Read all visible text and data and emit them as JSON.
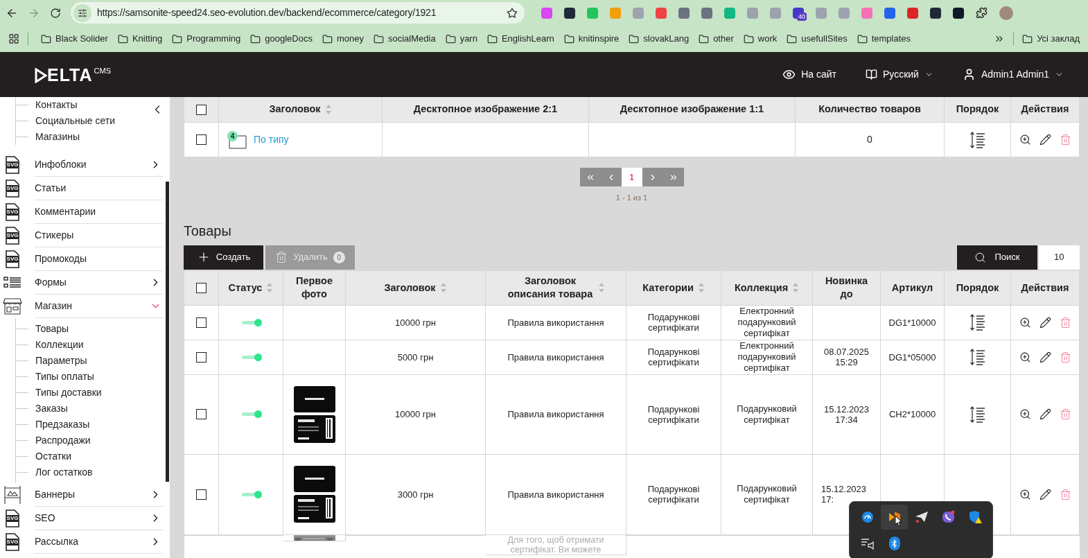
{
  "browser": {
    "url": "https://samsonite-speed24.seo-evolution.dev/backend/ecommerce/category/1921",
    "extension_badge": "40",
    "bookmarks": [
      "Black Solider",
      "Knitting",
      "Programming",
      "googleDocs",
      "money",
      "socialMedia",
      "yarn",
      "EnglishLearn",
      "knitinspire",
      "slovakLang",
      "other",
      "work",
      "usefullSites",
      "templates"
    ],
    "all_bookmarks": "Усі заклад"
  },
  "header": {
    "logo": "ELTA",
    "logo_sup": "CMS",
    "site_link": "На сайт",
    "language": "Русский",
    "user": "Admin1 Admin1"
  },
  "sidebar": {
    "partial_children": [
      "Контакты",
      "Социальные сети",
      "Магазины"
    ],
    "items": [
      {
        "label": "Инфоблоки",
        "kind": "group",
        "icon_label": "SVG",
        "expanded": false
      },
      {
        "label": "Статьи",
        "kind": "link",
        "icon_label": "SVG"
      },
      {
        "label": "Комментарии",
        "kind": "link",
        "icon_label": "SVG"
      },
      {
        "label": "Стикеры",
        "kind": "link",
        "icon_label": "SVG"
      },
      {
        "label": "Промокоды",
        "kind": "link",
        "icon_label": "SVG"
      },
      {
        "label": "Формы",
        "kind": "group",
        "expanded": false
      },
      {
        "label": "Магазин",
        "kind": "group",
        "expanded": true,
        "children": [
          "Товары",
          "Коллекции",
          "Параметры",
          "Типы оплаты",
          "Типы доставки",
          "Заказы",
          "Предзаказы",
          "Распродажи",
          "Остатки",
          "Лог остатков"
        ]
      },
      {
        "label": "Баннеры",
        "kind": "group",
        "expanded": false
      },
      {
        "label": "SEO",
        "kind": "group",
        "icon_label": "SVG",
        "expanded": false
      },
      {
        "label": "Рассылка",
        "kind": "group",
        "icon_label": "SVG",
        "expanded": false
      }
    ]
  },
  "category_table": {
    "header_checked": false,
    "columns": [
      {
        "label": "Заголовок",
        "sortable": true
      },
      {
        "label": "Десктопное изображение 2:1",
        "sortable": false
      },
      {
        "label": "Десктопное изображение 1:1",
        "sortable": false
      },
      {
        "label": "Количество товаров",
        "sortable": false
      },
      {
        "label": "Порядок",
        "sortable": false
      },
      {
        "label": "Действия",
        "sortable": false
      }
    ],
    "rows": [
      {
        "checked": false,
        "title": "По типу",
        "children_count": "4",
        "quantity": "0"
      }
    ],
    "pagination": {
      "pages": [
        {
          "label": "1",
          "selected": true
        }
      ],
      "summary": "1 - 1 из 1"
    }
  },
  "products": {
    "title": "Товары",
    "create": "Создать",
    "delete": {
      "label": "Удалить",
      "count": "0",
      "disabled": true
    },
    "search": "Поиск",
    "per_page": "10",
    "header_checked": false,
    "columns": [
      {
        "label": "Статус",
        "sortable": true
      },
      {
        "label": "Первое фото",
        "sortable": false
      },
      {
        "label": "Заголовок",
        "sortable": true
      },
      {
        "label": "Заголовок описания товара",
        "sortable": true
      },
      {
        "label": "Категории",
        "sortable": true
      },
      {
        "label": "Коллекция",
        "sortable": true
      },
      {
        "label": "Новинка до",
        "sortable": false
      },
      {
        "label": "Артикул",
        "sortable": false
      },
      {
        "label": "Порядок",
        "sortable": false
      },
      {
        "label": "Действия",
        "sortable": false
      }
    ],
    "rows": [
      {
        "checked": false,
        "status_on": true,
        "photo": false,
        "title": "10000 грн",
        "desc_title": "Правила використання",
        "category": "Подарункові сертифікати",
        "collection": "Електронний подарунковий сертифікат",
        "sku": "DG1*10000"
      },
      {
        "checked": false,
        "status_on": true,
        "photo": false,
        "title": "5000 грн",
        "desc_title": "Правила використання",
        "category": "Подарункові сертифікати",
        "collection": "Електронний подарунковий сертифікат",
        "new_until": "08.07.2025 15:29",
        "sku": "DG1*05000"
      },
      {
        "checked": false,
        "status_on": true,
        "photo": true,
        "title": "10000 грн",
        "desc_title": "Правила використання",
        "category": "Подарункові сертифікати",
        "collection": "Подарунковий сертифікат",
        "new_until": "15.12.2023 17:34",
        "sku": "CH2*10000"
      },
      {
        "checked": false,
        "status_on": true,
        "photo": true,
        "covered": true,
        "title": "3000 грн",
        "desc_title": "Правила використання",
        "category": "Подарункові сертифікати",
        "collection": "Подарунковий сертифікат",
        "new_until": "15.12.2023 17:"
      },
      {
        "partial": true,
        "photo": true,
        "desc_title": "Для того, щоб отримати сертифікат. Ви можете"
      }
    ]
  },
  "tray": [
    {
      "kind": "gauge",
      "selected": false
    },
    {
      "kind": "fragment",
      "selected": true
    },
    {
      "kind": "paperplane",
      "selected": false
    },
    {
      "kind": "phone",
      "selected": false
    },
    {
      "kind": "shield",
      "selected": false
    },
    {
      "kind": "speaker",
      "selected": false
    },
    {
      "kind": "bluetooth",
      "selected": false
    }
  ]
}
